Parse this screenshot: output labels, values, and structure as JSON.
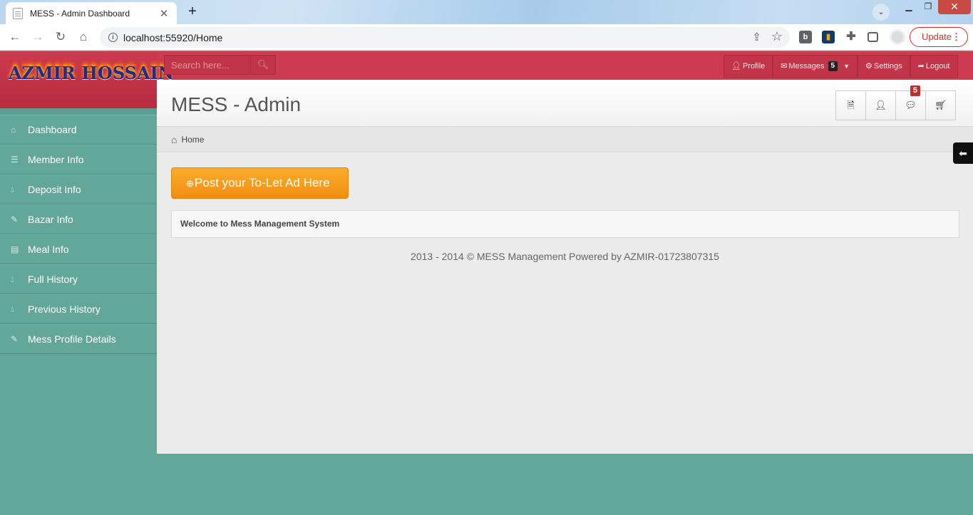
{
  "browser": {
    "tab_title": "MESS - Admin Dashboard",
    "tab_close": "✕",
    "new_tab": "+",
    "url": "localhost:55920/Home",
    "update_label": "Update"
  },
  "app": {
    "logo_text": "AZMIR HOSSAIN",
    "search": {
      "placeholder": "Search here..."
    },
    "topnav": {
      "profile": "Profile",
      "messages": "Messages",
      "messages_count": "5",
      "settings": "Settings",
      "logout": "Logout"
    },
    "sidebar": {
      "items": [
        {
          "label": "Dashboard",
          "icon": "home-icon"
        },
        {
          "label": "Member Info",
          "icon": "list-icon"
        },
        {
          "label": "Deposit Info",
          "icon": "drop-icon"
        },
        {
          "label": "Bazar Info",
          "icon": "pencil-icon"
        },
        {
          "label": "Meal Info",
          "icon": "book-icon"
        },
        {
          "label": "Full History",
          "icon": "drop-icon"
        },
        {
          "label": "Previous History",
          "icon": "drop-icon"
        },
        {
          "label": "Mess Profile Details",
          "icon": "pencil-icon"
        }
      ]
    },
    "page_title": "MESS - Admin",
    "quick_buttons": {
      "comments_badge": "5"
    },
    "breadcrumb": {
      "home": "Home"
    },
    "post_button": "Post your To-Let Ad Here",
    "welcome_text": "Welcome to Mess Management System",
    "footer": "2013 - 2014 © MESS Management Powered by AZMIR-01723807315"
  },
  "colors": {
    "topbar": "#cc3b4f",
    "sidebar": "#63a799",
    "post_button": "#f28e12"
  }
}
